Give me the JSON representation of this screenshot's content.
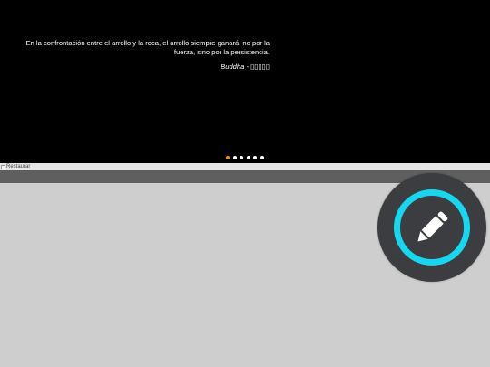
{
  "slider": {
    "quote_text": "En la confrontación entre el arrollo y la roca, el arrollo siempre ganará, no por la fuerza, sino por la persistencia.",
    "quote_author": "Buddha - ▯▯▯▯▯",
    "dot_count": 6,
    "active_dot_index": 0,
    "active_dot_color": "#ff8a00",
    "dot_color": "#ffffff"
  },
  "restore": {
    "alt_text": "Restaurar"
  },
  "edit_button": {
    "icon": "pencil-icon",
    "ring_color": "#19d6ee",
    "background_color": "#3b3d40"
  }
}
